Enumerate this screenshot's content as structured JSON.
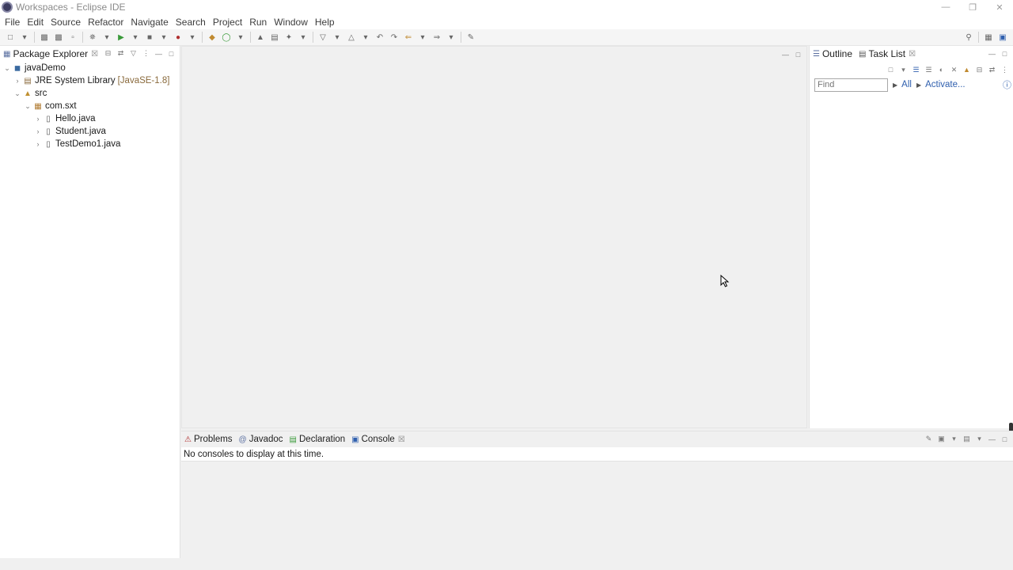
{
  "window": {
    "title": "Workspaces - Eclipse IDE",
    "controls": [
      "minimize-icon",
      "restore-icon",
      "close-icon"
    ]
  },
  "menu": [
    "File",
    "Edit",
    "Source",
    "Refactor",
    "Navigate",
    "Search",
    "Project",
    "Run",
    "Window",
    "Help"
  ],
  "package_explorer": {
    "tab_label": "Package Explorer",
    "tree": {
      "project": "javaDemo",
      "jre": "JRE System Library",
      "jre_version": "[JavaSE-1.8]",
      "src": "src",
      "package": "com.sxt",
      "files": [
        "Hello.java",
        "Student.java",
        "TestDemo1.java"
      ]
    }
  },
  "right_panel": {
    "outline_label": "Outline",
    "tasklist_label": "Task List",
    "find_placeholder": "Find",
    "all_link": "All",
    "activate_link": "Activate..."
  },
  "console": {
    "tabs": [
      "Problems",
      "Javadoc",
      "Declaration",
      "Console"
    ],
    "message": "No consoles to display at this time."
  }
}
